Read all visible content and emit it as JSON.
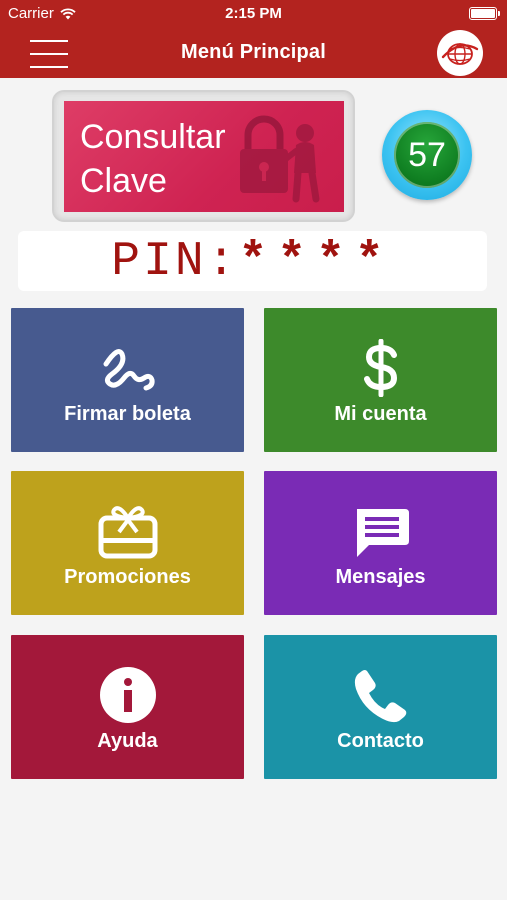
{
  "status_bar": {
    "carrier": "Carrier",
    "time": "2:15 PM",
    "battery_level_percent": 100
  },
  "header": {
    "title": "Menú Principal",
    "menu_icon": "hamburger-menu-icon",
    "logo_icon": "globe-logo-icon"
  },
  "consultar_clave": {
    "label_line1": "Consultar",
    "label_line2": "Clave",
    "art_icon": "padlock-figure-icon"
  },
  "counter": {
    "value": "57"
  },
  "pin": {
    "label": "PIN:",
    "value": "****"
  },
  "tiles": [
    {
      "label": "Firmar boleta",
      "icon": "signature-icon",
      "color": "#475a8f"
    },
    {
      "label": "Mi cuenta",
      "icon": "dollar-icon",
      "color": "#3d8a2b"
    },
    {
      "label": "Promociones",
      "icon": "gift-card-icon",
      "color": "#bea21c"
    },
    {
      "label": "Mensajes",
      "icon": "message-icon",
      "color": "#7a2bb5"
    },
    {
      "label": "Ayuda",
      "icon": "info-icon",
      "color": "#a3183a"
    },
    {
      "label": "Contacto",
      "icon": "phone-icon",
      "color": "#1b93a7"
    }
  ],
  "colors": {
    "brand_red": "#b3231f",
    "pin_red": "#a0130f",
    "clave_pink": "#d22a57",
    "counter_blue": "#3cc3f1",
    "counter_green": "#0e7c20"
  }
}
